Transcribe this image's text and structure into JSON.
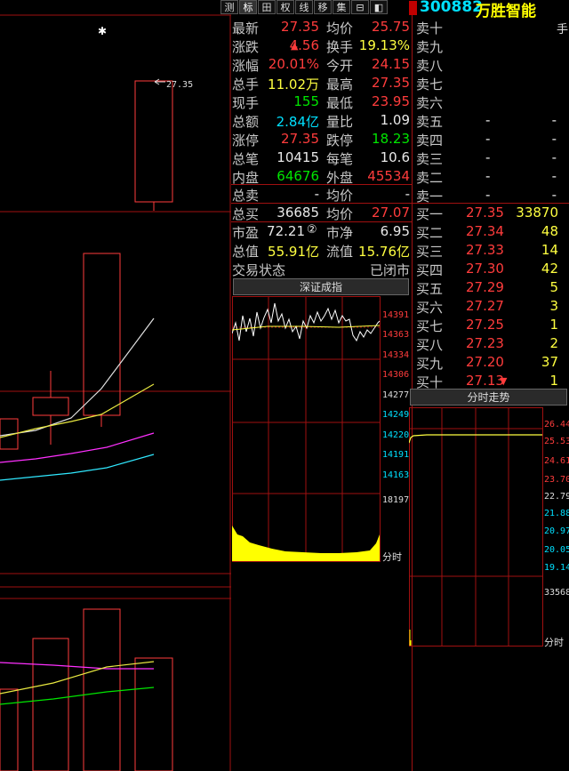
{
  "toolbar": {
    "tabs": [
      "测",
      "标",
      "田",
      "权",
      "线",
      "移",
      "集",
      "⊟",
      "◧"
    ]
  },
  "stock": {
    "code": "300882",
    "name": "万胜智能"
  },
  "kline": {
    "high_marker": "27.35"
  },
  "quote": {
    "rows": [
      {
        "l1": "最新",
        "v1": "27.35",
        "l2": "均价",
        "v2": "25.75"
      },
      {
        "l1": "涨跌",
        "v1": "4.56",
        "l2": "换手",
        "v2": "19.13%"
      },
      {
        "l1": "涨幅",
        "v1": "20.01%",
        "l2": "今开",
        "v2": "24.15"
      },
      {
        "l1": "总手",
        "v1": "11.02万",
        "l2": "最高",
        "v2": "27.35"
      },
      {
        "l1": "现手",
        "v1": "155",
        "l2": "最低",
        "v2": "23.95"
      },
      {
        "l1": "总额",
        "v1": "2.84亿",
        "l2": "量比",
        "v2": "1.09"
      },
      {
        "l1": "涨停",
        "v1": "27.35",
        "l2": "跌停",
        "v2": "18.23"
      },
      {
        "l1": "总笔",
        "v1": "10415",
        "l2": "每笔",
        "v2": "10.6"
      },
      {
        "l1": "内盘",
        "v1": "64676",
        "l2": "外盘",
        "v2": "45534"
      },
      {
        "l1": "总卖",
        "v1": "-",
        "l2": "均价",
        "v2": "-"
      },
      {
        "l1": "总买",
        "v1": "36685",
        "l2": "均价",
        "v2": "27.07"
      },
      {
        "l1": "市盈",
        "v1": "72.21",
        "l2": "市净",
        "v2": "6.95"
      },
      {
        "l1": "总值",
        "v1": "55.91亿",
        "l2": "流值",
        "v2": "15.76亿"
      }
    ],
    "pe_badge": "②",
    "trade_status_label": "交易状态",
    "trade_status_value": "已闭市"
  },
  "orderbook": {
    "unit": "手",
    "sell": [
      {
        "label": "卖十",
        "price": "",
        "vol": ""
      },
      {
        "label": "卖九",
        "price": "",
        "vol": ""
      },
      {
        "label": "卖八",
        "price": "",
        "vol": ""
      },
      {
        "label": "卖七",
        "price": "",
        "vol": ""
      },
      {
        "label": "卖六",
        "price": "",
        "vol": ""
      },
      {
        "label": "卖五",
        "price": "-",
        "vol": "-"
      },
      {
        "label": "卖四",
        "price": "-",
        "vol": "-"
      },
      {
        "label": "卖三",
        "price": "-",
        "vol": "-"
      },
      {
        "label": "卖二",
        "price": "-",
        "vol": "-"
      },
      {
        "label": "卖一",
        "price": "-",
        "vol": "-"
      }
    ],
    "buy": [
      {
        "label": "买一",
        "price": "27.35",
        "vol": "33870"
      },
      {
        "label": "买二",
        "price": "27.34",
        "vol": "48"
      },
      {
        "label": "买三",
        "price": "27.33",
        "vol": "14"
      },
      {
        "label": "买四",
        "price": "27.30",
        "vol": "42"
      },
      {
        "label": "买五",
        "price": "27.29",
        "vol": "5"
      },
      {
        "label": "买六",
        "price": "27.27",
        "vol": "3"
      },
      {
        "label": "买七",
        "price": "27.25",
        "vol": "1"
      },
      {
        "label": "买八",
        "price": "27.23",
        "vol": "2"
      },
      {
        "label": "买九",
        "price": "27.20",
        "vol": "37"
      },
      {
        "label": "买十",
        "price": "27.13",
        "vol": "1"
      }
    ]
  },
  "index_panel": {
    "title": "深证成指",
    "price_ticks": [
      "14391",
      "14363",
      "14334",
      "14306",
      "14277",
      "14249",
      "14220",
      "14191",
      "14163"
    ],
    "vol_tick": "18197",
    "time_label": "分时"
  },
  "intraday_panel": {
    "title": "分时走势",
    "price_ticks": [
      "26.44",
      "25.53",
      "24.61",
      "23.70",
      "22.79",
      "21.88",
      "20.97",
      "20.05",
      "19.14"
    ],
    "vol_tick": "33568",
    "time_label": "分时"
  },
  "colors": {
    "up": "#ff3c3c",
    "down": "#00e600",
    "grid": "#a01010",
    "avg": "#ffff40"
  }
}
